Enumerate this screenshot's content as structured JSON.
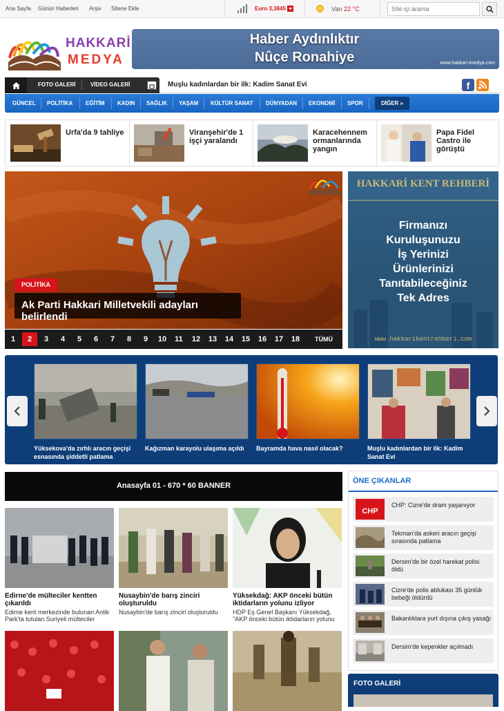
{
  "topbar": {
    "links": [
      "Ana Sayfa",
      "Günün Haberleri",
      "Arşiv",
      "Sitene Ekle"
    ],
    "currency_label": "Euro 3,3845",
    "weather_city": "Van",
    "weather_temp": "22 °C",
    "search_placeholder": "Site içi arama"
  },
  "header": {
    "logo_line1": "HAKKARİ",
    "logo_line2": "MEDYA",
    "banner_line1": "Haber Aydınlıktır",
    "banner_line2": "Nûçe Ronahiye",
    "banner_url": "www.hakkari-imedya.com"
  },
  "nav": {
    "foto_galeri": "FOTO GALERİ",
    "video_galeri": "VİDEO GALERİ",
    "ticker": "Muşlu kadınlardan bir ilk: Kadim Sanat Evi"
  },
  "menu": {
    "items": [
      "GÜNCEL",
      "POLİTİKA",
      "EĞİTİM",
      "KADIN",
      "SAĞLIK",
      "YAŞAM",
      "KÜLTÜR SANAT",
      "DÜNYADAN",
      "EKONOMİ",
      "SPOR"
    ],
    "more": "DİĞER »"
  },
  "strip": [
    {
      "title": "Urfa'da 9 tahliye"
    },
    {
      "title": "Viranşehir'de 1 işçi yaralandı"
    },
    {
      "title": "Karacehennem ormanlarında yangın"
    },
    {
      "title": "Papa Fidel Castro ile görüştü"
    }
  ],
  "slider": {
    "category": "POLİTİKA",
    "title": "Ak Parti Hakkari Milletvekili adayları belirlendi",
    "pages": [
      "1",
      "2",
      "3",
      "4",
      "5",
      "6",
      "7",
      "8",
      "9",
      "10",
      "11",
      "12",
      "13",
      "14",
      "15",
      "16",
      "17",
      "18"
    ],
    "active_page": "2",
    "all_label": "TÜMÜ"
  },
  "ad": {
    "heading": "HAKKARİ KENT REHBERİ",
    "lines": [
      "Firmanızı",
      "Kuruluşunuzu",
      "İş Yerinizi",
      "Ürünlerinizi",
      "Tanıtabileceğiniz",
      "Tek Adres"
    ],
    "url": "www.hakkarikentrehberi.com"
  },
  "carousel": [
    {
      "title": "Yüksekova'da zırhlı aracın geçişi esnasında şiddetli patlama"
    },
    {
      "title": "Kağızman karayolu ulaşıma açıldı"
    },
    {
      "title": "Bayramda hava nasıl olacak?"
    },
    {
      "title": "Muşlu kadınlardan bir ilk: Kadim Sanat Evi"
    }
  ],
  "mid_banner": "Anasayfa 01 - 670 * 60 BANNER",
  "news": [
    {
      "title": "Edirne'de mülteciler kentten çıkarıldı",
      "desc": "Edirne kent merkezinde bulunan Antik Park'ta tutulan Suriyeli mülteciler"
    },
    {
      "title": "Nusaybin'de barış zinciri oluşturuldu",
      "desc": "Nusaybin'de barış zinciri oluşturuldu"
    },
    {
      "title": "Yüksekdağ: AKP önceki bütün iktidarların yolunu izliyor",
      "desc": "HDP Eş Genel Başkanı Yüksekdağ, \"AKP önceki bütün iktidarların yolunu"
    }
  ],
  "sidebar": {
    "heading": "ÖNE ÇIKANLAR",
    "items": [
      "CHP: Cizre'de dram yaşanıyor",
      "Tekman'da askeri aracın geçişi sırasında patlama",
      "Dersim'de bir özel harekat polisi öldü",
      "Cizre'de polis ablukası 35 günlük bebeği öldürdü",
      "Bakanlıklara yurt dışına çıkış yasağı",
      "Dersim'de kepenkler açılmadı"
    ],
    "chp_logo": "CHP",
    "foto_galeri": "FOTO GALERİ"
  },
  "colors": {
    "menu_blue": "#1b6ac7",
    "accent_red": "#d7141a",
    "dark_navy": "#0e3d78"
  }
}
